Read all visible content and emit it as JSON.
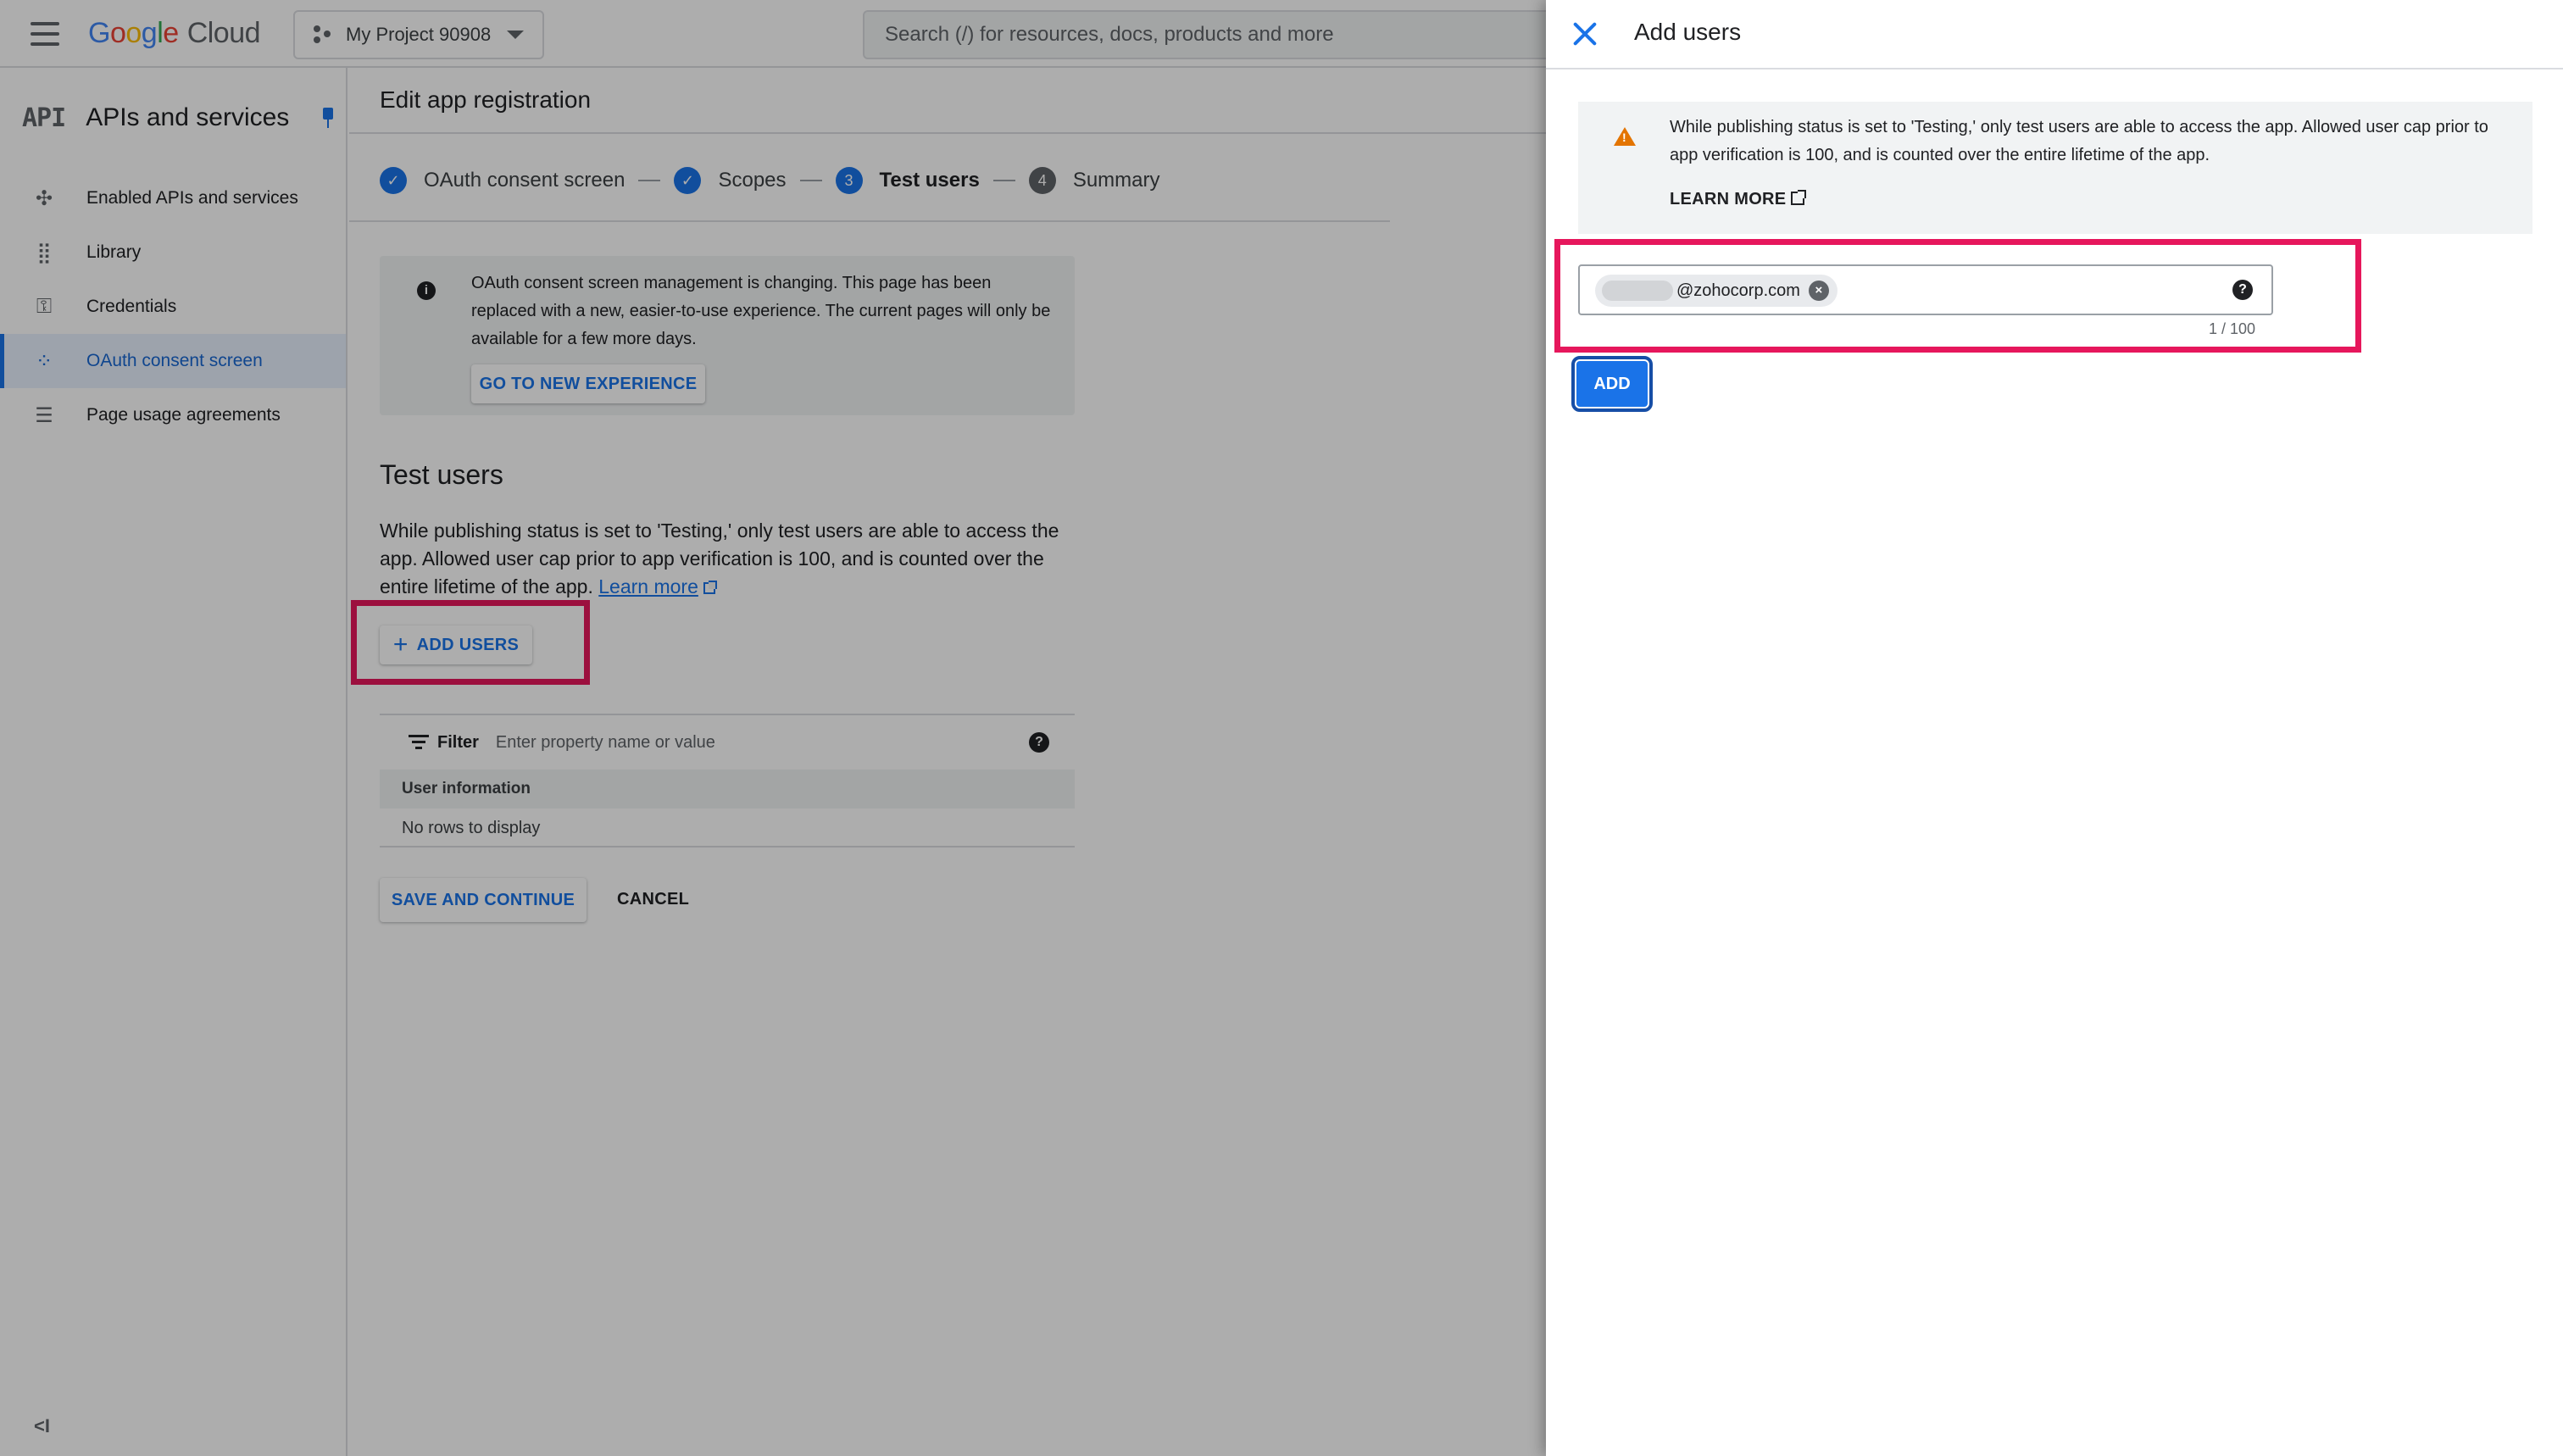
{
  "topbar": {
    "logo_google": [
      "G",
      "o",
      "o",
      "g",
      "l",
      "e"
    ],
    "logo_cloud": "Cloud",
    "project_name": "My Project 90908",
    "search_placeholder": "Search (/) for resources, docs, products and more"
  },
  "sidebar": {
    "badge": "API",
    "title": "APIs and services",
    "items": [
      {
        "label": "Enabled APIs and services",
        "icon": "hub-icon",
        "glyph": "✣"
      },
      {
        "label": "Library",
        "icon": "library-grid-icon",
        "glyph": "⣿"
      },
      {
        "label": "Credentials",
        "icon": "key-icon",
        "glyph": "⚿"
      },
      {
        "label": "OAuth consent screen",
        "icon": "consent-dots-icon",
        "glyph": "⁘",
        "active": true
      },
      {
        "label": "Page usage agreements",
        "icon": "settings-list-icon",
        "glyph": "☰"
      }
    ],
    "collapse_glyph": "<I"
  },
  "main": {
    "title": "Edit app registration",
    "steps": [
      {
        "label": "OAuth consent screen",
        "state": "done",
        "mark": "✓"
      },
      {
        "label": "Scopes",
        "state": "done",
        "mark": "✓"
      },
      {
        "label": "Test users",
        "state": "current",
        "mark": "3"
      },
      {
        "label": "Summary",
        "state": "todo",
        "mark": "4"
      }
    ],
    "notice_text": "OAuth consent screen management is changing. This page has been replaced with a new, easier-to-use experience. The current pages will only be available for a few more days.",
    "notice_button": "GO TO NEW EXPERIENCE",
    "test_users_title": "Test users",
    "test_users_desc": "While publishing status is set to 'Testing,' only test users are able to access the app. Allowed user cap prior to app verification is 100, and is counted over the entire lifetime of the app.",
    "learn_more_link": "Learn more",
    "add_users_button": "ADD USERS",
    "filter_label": "Filter",
    "filter_placeholder": "Enter property name or value",
    "table_header": "User information",
    "empty_text": "No rows to display",
    "save_button": "SAVE AND CONTINUE",
    "cancel_button": "CANCEL"
  },
  "drawer": {
    "title": "Add users",
    "warning_text": "While publishing status is set to 'Testing,' only test users are able to access the app. Allowed user cap prior to app verification is 100, and is counted over the entire lifetime of the app.",
    "learn_more": "LEARN MORE",
    "chip_email_suffix": "@zohocorp.com",
    "counter": "1 / 100",
    "add_button": "ADD"
  },
  "colors": {
    "accent": "#1a73e8",
    "highlight": "#e6175c",
    "warning": "#e37400"
  }
}
